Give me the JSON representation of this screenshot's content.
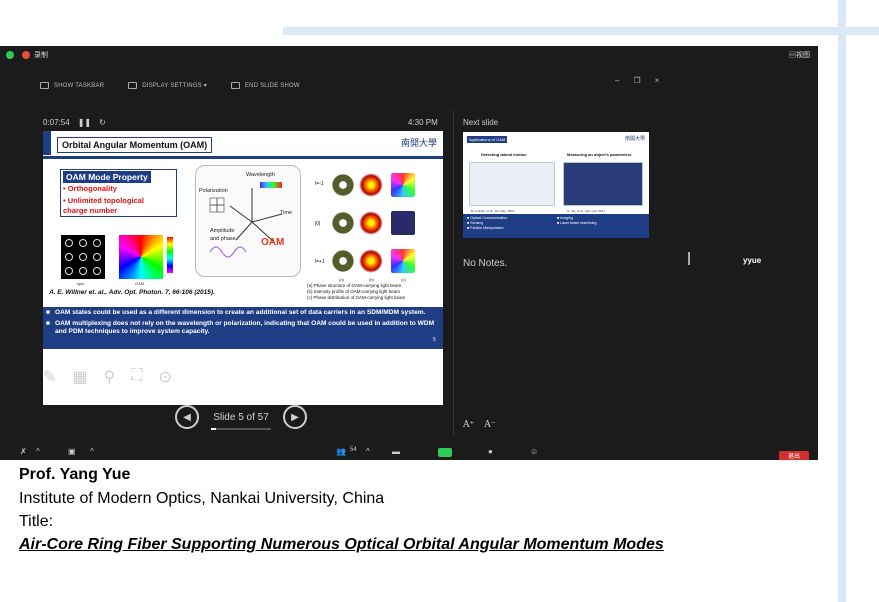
{
  "window": {
    "record_label": "录制",
    "view_label": "▤视图"
  },
  "toolbar": {
    "show_taskbar": "SHOW TASKBAR",
    "display_settings": "DISPLAY SETTINGS ▾",
    "end_slide_show": "END SLIDE SHOW"
  },
  "presenter": {
    "elapsed": "0:07:54",
    "clock": "4:30 PM",
    "slide_counter": "Slide 5 of 57",
    "progress_fraction": 0.0877,
    "next_slide_label": "Next slide",
    "notes": "No Notes.",
    "speaker": "yyue"
  },
  "slide": {
    "title": "Orbital Angular Momentum (OAM)",
    "university": "南開大學",
    "property_title": "OAM Mode Property",
    "property_items": [
      "• Orthogonality",
      "• Unlimited topological",
      "charge number"
    ],
    "diagram_labels": {
      "wavelength": "Wavelength",
      "polarization": "Polarization",
      "time": "Time",
      "amplitude": "Amplitude",
      "and_phase": "and phase",
      "oam": "OAM"
    },
    "img_labels": [
      "spin",
      "OAM"
    ],
    "row_labels": [
      "l=-1",
      "|0|",
      "l=+1"
    ],
    "col_labels": [
      "(a)",
      "(b)",
      "(c)"
    ],
    "captions": [
      "(a) Phase structure of OAM-carrying light beam",
      "(b) Intensity profile of OAM-carrying light beam",
      "(c) Phase distribution of OAM-carrying light beam"
    ],
    "reference": "A. E. Willner et. al., Adv. Opt. Photon. 7, 66-106 (2015).",
    "bullets": [
      "OAM states could be used as a different dimension to create an additional set of data carriers in an SDM/MDM system.",
      "OAM multiplexing does not rely on the wavelength or polarization, indicating that OAM could be used in addition to WDM and PDM techniques to improve system capacity."
    ],
    "page_number": "5"
  },
  "next_slide": {
    "title": "Applications of OAM",
    "university": "南開大學",
    "left_head": "Detecting lateral motion",
    "right_head": "Measuring an object's parameters",
    "left_ref": "M. Cvijetic, et al., Sci. Rep. 2016",
    "right_ref": "G. Xie, et al., Opt. Lett. 2017",
    "bullets_left": [
      "■ Optical Communication",
      "■ Sensing",
      "■ Particle Manipulation"
    ],
    "bullets_right": [
      "■ Imaging",
      "■ Laser beam machining"
    ]
  },
  "bottom_bar": {
    "participants": "54",
    "end_label": "退出"
  },
  "caption": {
    "name": "Prof. Yang Yue",
    "institute": "Institute  of Modern  Optics,  Nankai  University,  China",
    "title_label": "Title:",
    "title": "Air-Core Ring Fiber Supporting  Numerous Optical  Orbital  Angular  Momentum Modes"
  }
}
